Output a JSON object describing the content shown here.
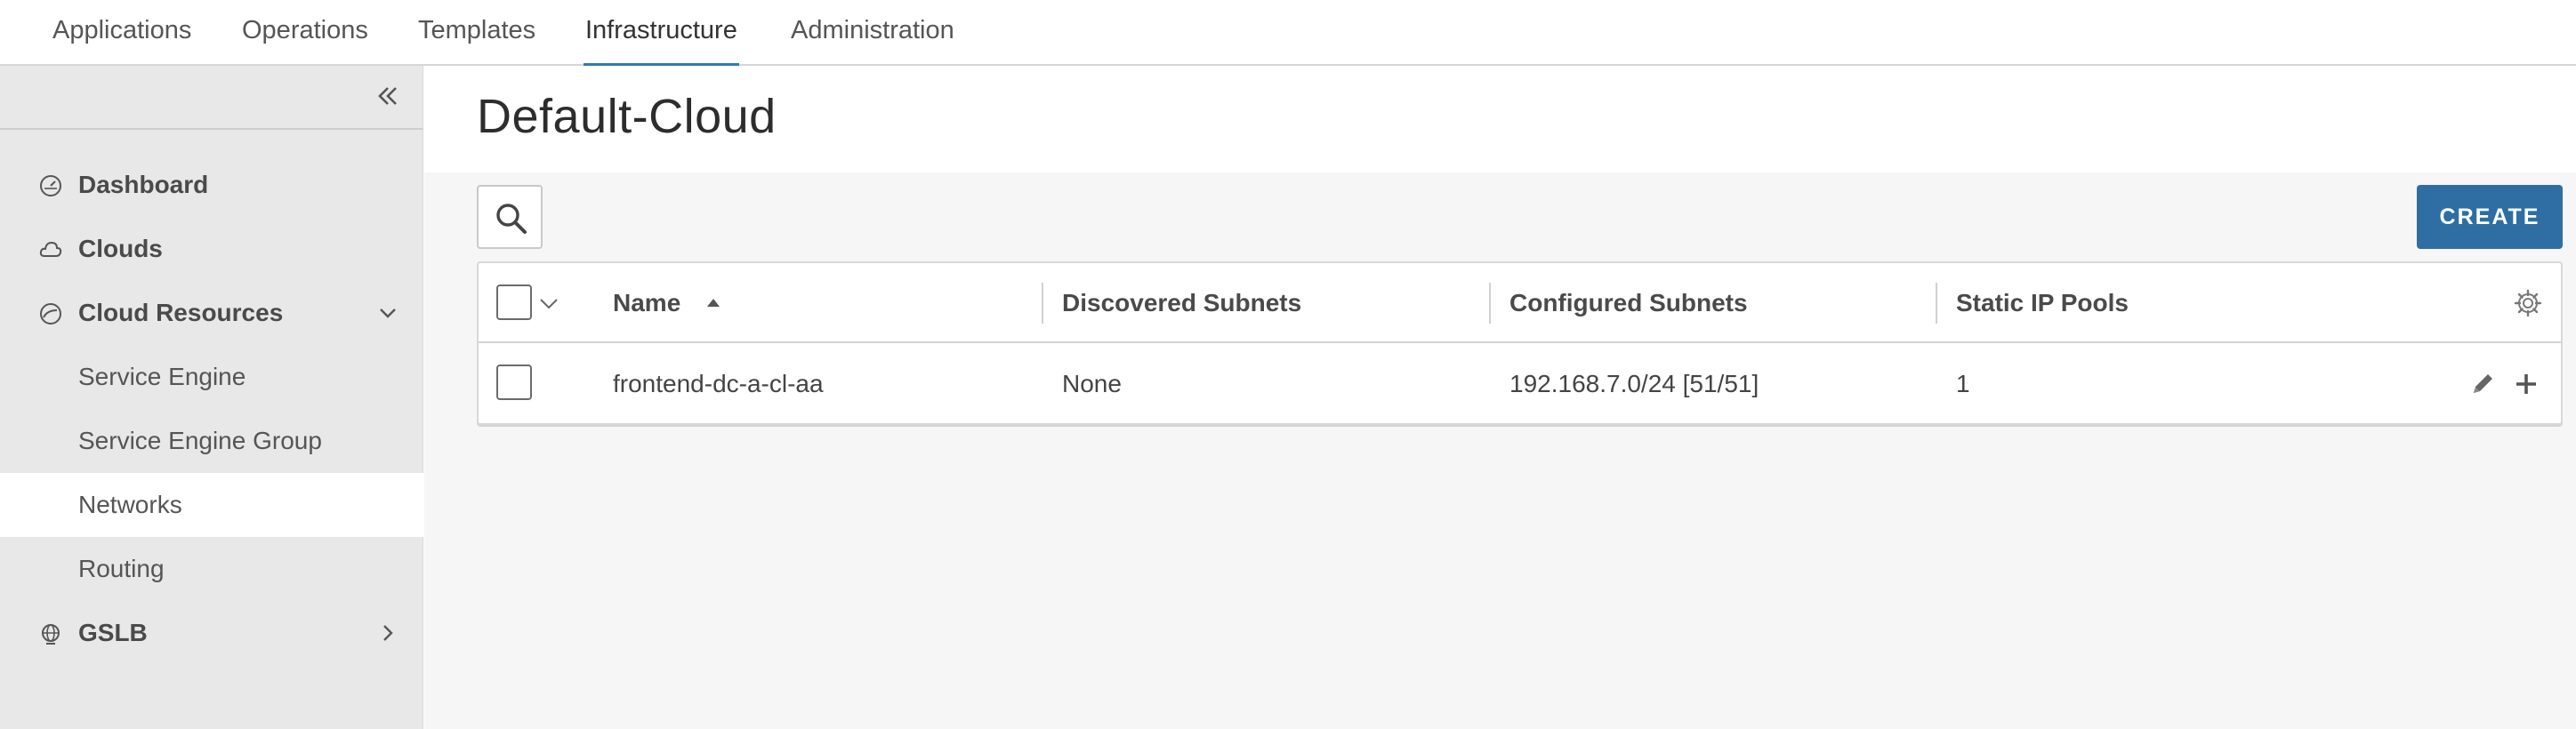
{
  "topnav": {
    "tabs": [
      {
        "label": "Applications"
      },
      {
        "label": "Operations"
      },
      {
        "label": "Templates"
      },
      {
        "label": "Infrastructure",
        "active": true
      },
      {
        "label": "Administration"
      }
    ]
  },
  "sidebar": {
    "collapse_icon": "double-chevron-left-icon",
    "items": [
      {
        "label": "Dashboard",
        "icon": "dashboard-gauge-icon",
        "type": "parent"
      },
      {
        "label": "Clouds",
        "icon": "cloud-icon",
        "type": "parent"
      },
      {
        "label": "Cloud Resources",
        "icon": "cloud-resources-gauge-icon",
        "type": "parent",
        "expanded": true
      },
      {
        "label": "Service Engine",
        "type": "child"
      },
      {
        "label": "Service Engine Group",
        "type": "child"
      },
      {
        "label": "Networks",
        "type": "child",
        "selected": true
      },
      {
        "label": "Routing",
        "type": "child"
      },
      {
        "label": "GSLB",
        "icon": "globe-icon",
        "type": "parent",
        "expanded": false
      }
    ]
  },
  "main": {
    "title": "Default-Cloud",
    "create_label": "CREATE",
    "table": {
      "columns": [
        "Name",
        "Discovered Subnets",
        "Configured Subnets",
        "Static IP Pools"
      ],
      "sort": {
        "column": "Name",
        "direction": "ascending"
      },
      "rows": [
        {
          "name": "frontend-dc-a-cl-aa",
          "discovered_subnets": "None",
          "configured_subnets": "192.168.7.0/24 [51/51]",
          "static_ip_pools": "1"
        }
      ]
    }
  },
  "colors": {
    "accent": "#2b7cb3",
    "create_button": "#2e6ea3",
    "sidebar_bg": "#e8e8e8",
    "content_bg": "#f6f6f6"
  }
}
